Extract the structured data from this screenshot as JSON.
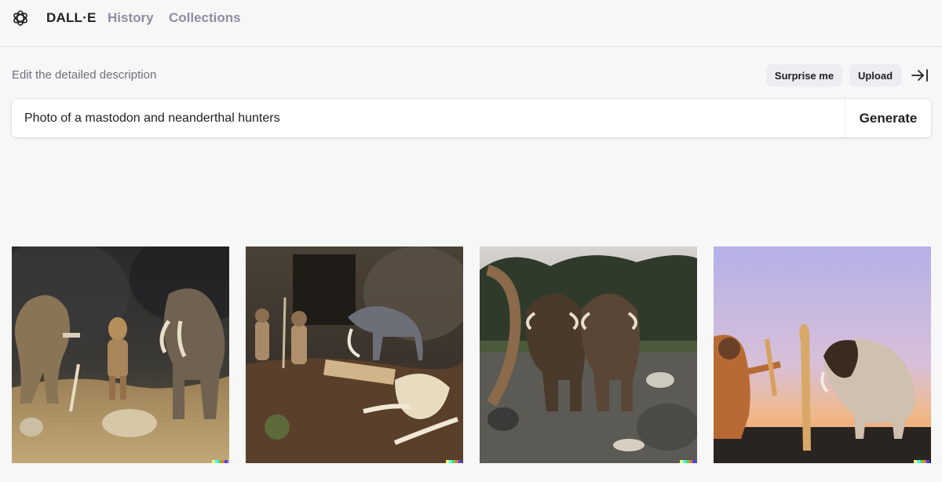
{
  "nav": {
    "brand": "DALL·E",
    "history": "History",
    "collections": "Collections"
  },
  "editor": {
    "label": "Edit the detailed description",
    "surprise_label": "Surprise me",
    "upload_label": "Upload",
    "prompt_value": "Photo of a mastodon and neanderthal hunters",
    "generate_label": "Generate"
  },
  "icons": {
    "logo": "openai-logo-icon",
    "collapse": "arrow-right-to-bar-icon"
  },
  "results": {
    "count": 4,
    "signature_colors": [
      "#ffff66",
      "#42ffff",
      "#51da4c",
      "#ff6e3c",
      "#3c46ff"
    ]
  }
}
